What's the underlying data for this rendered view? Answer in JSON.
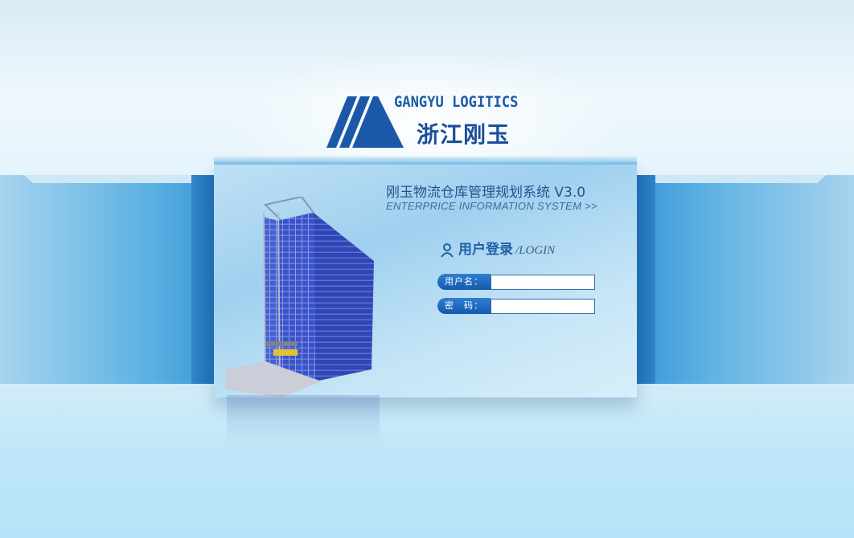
{
  "logo": {
    "english": "GANGYU LOGITICS",
    "chinese": "浙江刚玉",
    "mark_icon": "triangle-stripes-logo-icon"
  },
  "panel": {
    "title": "刚玉物流仓库管理规划系统 V3.0",
    "subtitle": "ENTERPRICE INFORMATION SYSTEM >>",
    "image": "warehouse-rack-illustration"
  },
  "login": {
    "heading_cn": "用户登录",
    "heading_en": "/LOGIN",
    "user_icon": "user-icon",
    "username_label": "用户名：",
    "username_value": "",
    "password_label": "密　码：",
    "password_value": ""
  },
  "colors": {
    "accent": "#1a5aa8",
    "panel_blue": "#9fd0ef",
    "label_blue": "#1559ad"
  }
}
